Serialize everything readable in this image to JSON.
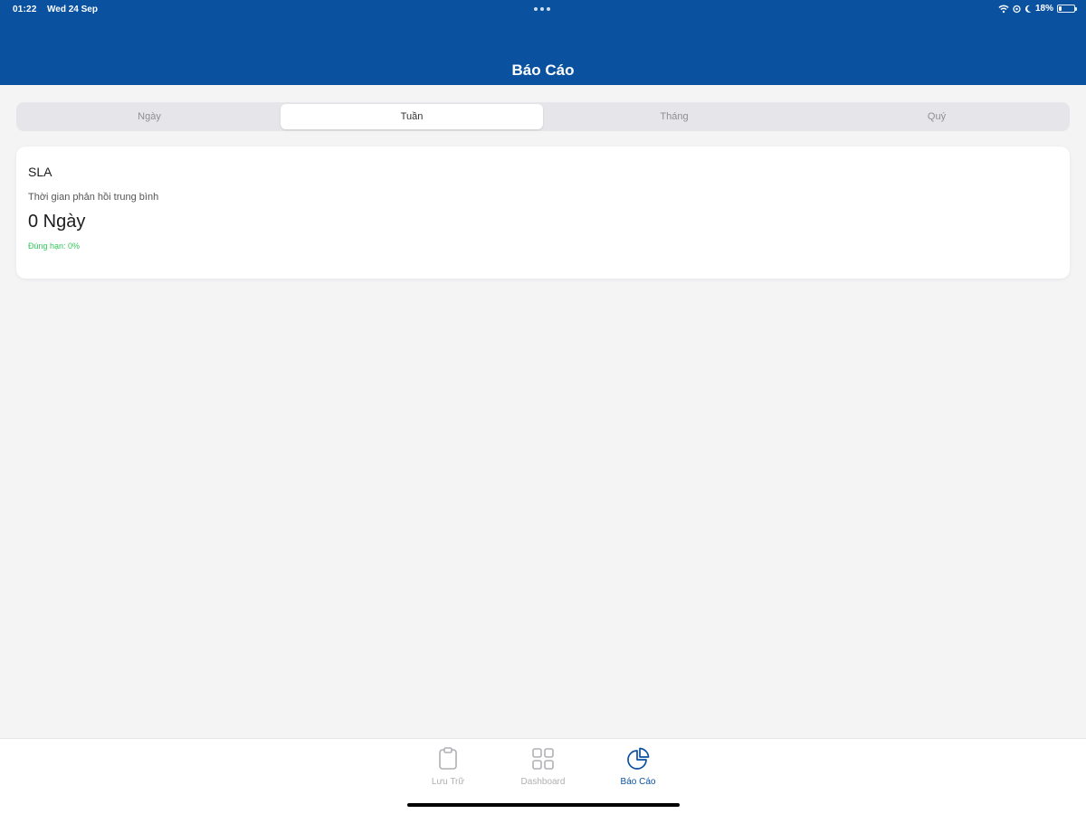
{
  "status_bar": {
    "time": "01:22",
    "date": "Wed 24 Sep",
    "battery": "18%"
  },
  "header": {
    "title": "Báo Cáo"
  },
  "segments": [
    {
      "label": "Ngày",
      "selected": false
    },
    {
      "label": "Tuần",
      "selected": true
    },
    {
      "label": "Tháng",
      "selected": false
    },
    {
      "label": "Quý",
      "selected": false
    }
  ],
  "sla_card": {
    "title": "SLA",
    "subtitle": "Thời gian phản hồi trung bình",
    "value": "0 Ngày",
    "note": "Đúng hạn: 0%",
    "note_color": "#34c759"
  },
  "tabbar": {
    "items": [
      {
        "label": "Lưu Trữ",
        "icon": "clipboard-icon",
        "active": false
      },
      {
        "label": "Dashboard",
        "icon": "grid-icon",
        "active": false
      },
      {
        "label": "Báo Cáo",
        "icon": "pie-chart-icon",
        "active": true
      }
    ]
  },
  "colors": {
    "brand": "#0a52a0",
    "inactive": "#b0b0b5"
  }
}
